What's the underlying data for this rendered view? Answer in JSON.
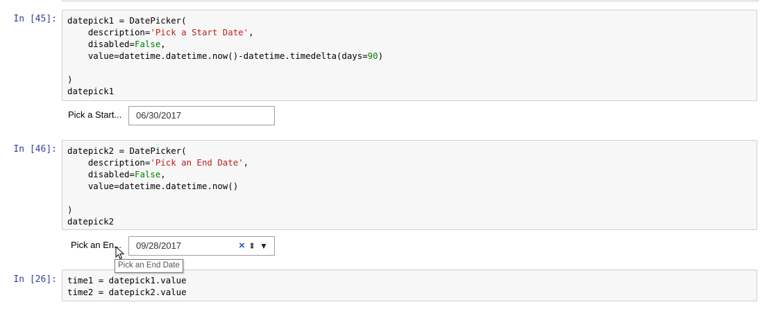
{
  "cells": [
    {
      "prompt": "In [45]:",
      "code": [
        [
          {
            "t": "datepick1 = DatePicker(",
            "c": ""
          }
        ],
        [
          {
            "t": "    description=",
            "c": ""
          },
          {
            "t": "'Pick a Start Date'",
            "c": "str"
          },
          {
            "t": ",",
            "c": ""
          }
        ],
        [
          {
            "t": "    disabled=",
            "c": ""
          },
          {
            "t": "False",
            "c": "kw"
          },
          {
            "t": ",",
            "c": ""
          }
        ],
        [
          {
            "t": "    value=datetime.datetime.now()-datetime.timedelta(days=",
            "c": ""
          },
          {
            "t": "90",
            "c": "num"
          },
          {
            "t": ")",
            "c": ""
          }
        ],
        [
          {
            "t": "",
            "c": ""
          }
        ],
        [
          {
            "t": ")",
            "c": ""
          }
        ],
        [
          {
            "t": "datepick1",
            "c": ""
          }
        ]
      ],
      "widget": {
        "label": "Pick a Start...",
        "value": "06/30/2017"
      }
    },
    {
      "prompt": "In [46]:",
      "code": [
        [
          {
            "t": "datepick2 = DatePicker(",
            "c": ""
          }
        ],
        [
          {
            "t": "    description=",
            "c": ""
          },
          {
            "t": "'Pick an End Date'",
            "c": "str"
          },
          {
            "t": ",",
            "c": ""
          }
        ],
        [
          {
            "t": "    disabled=",
            "c": ""
          },
          {
            "t": "False",
            "c": "kw"
          },
          {
            "t": ",",
            "c": ""
          }
        ],
        [
          {
            "t": "    value=datetime.datetime.now()",
            "c": ""
          }
        ],
        [
          {
            "t": "",
            "c": ""
          }
        ],
        [
          {
            "t": ")",
            "c": ""
          }
        ],
        [
          {
            "t": "datepick2",
            "c": ""
          }
        ]
      ],
      "widget": {
        "label": "Pick an En...",
        "value": "09/28/2017",
        "clear_glyph": "×",
        "spin_glyph": "⬍",
        "dropdown_glyph": "▼"
      }
    },
    {
      "prompt": "In [26]:",
      "code": [
        [
          {
            "t": "time1 = datepick1.value",
            "c": ""
          }
        ],
        [
          {
            "t": "time2 = datepick2.value",
            "c": ""
          }
        ]
      ]
    }
  ],
  "tooltip": "Pick an End Date",
  "colors": {
    "prompt": "#303f9f",
    "string": "#ba2121",
    "keyword": "#008000",
    "cell_bg": "#f7f7f7",
    "cell_border": "#cfcfcf"
  },
  "icons": {
    "cursor": "mouse-pointer-icon"
  }
}
